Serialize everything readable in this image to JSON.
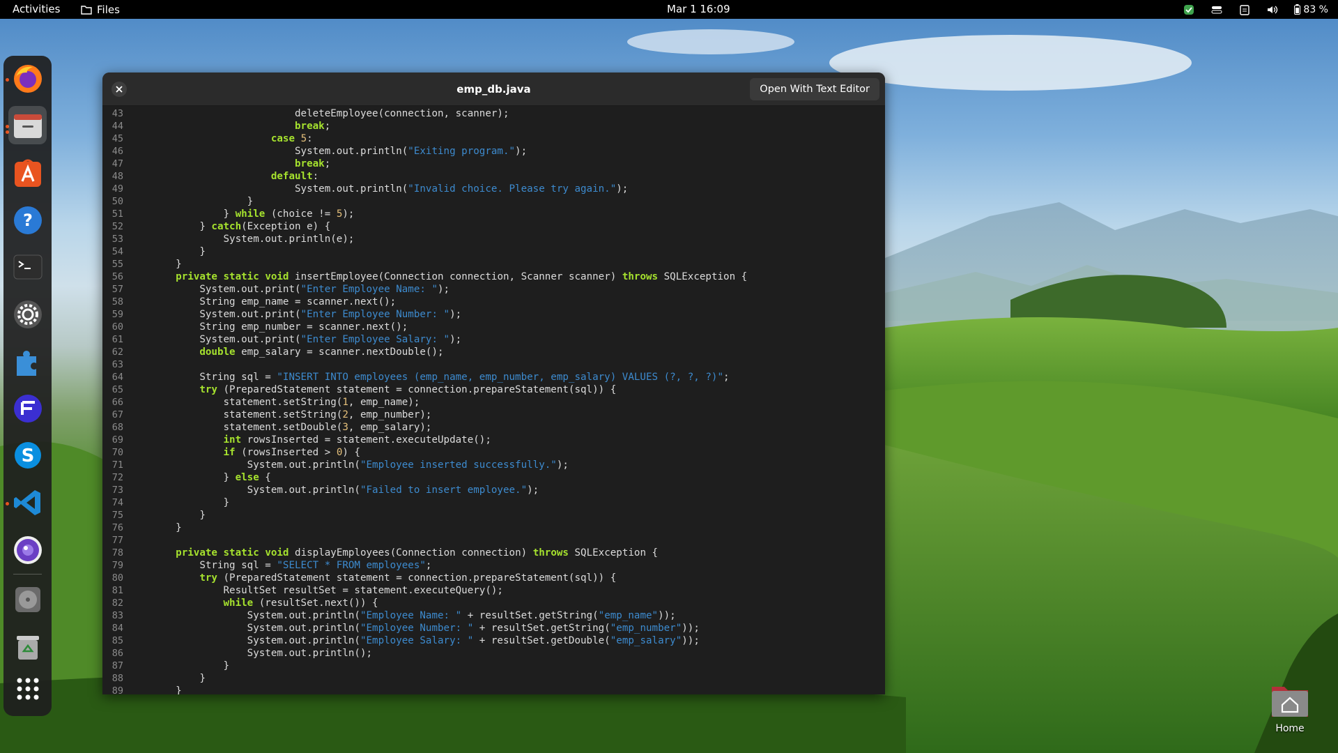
{
  "topbar": {
    "activities": "Activities",
    "app_name": "Files",
    "clock": "Mar 1  16:09",
    "battery": "83 %"
  },
  "dock": {
    "items": [
      {
        "icon": "firefox-icon",
        "running": true
      },
      {
        "icon": "files-icon",
        "running": true,
        "active": true
      },
      {
        "icon": "app-center-icon"
      },
      {
        "icon": "help-icon"
      },
      {
        "icon": "terminal-icon"
      },
      {
        "icon": "settings-icon"
      },
      {
        "icon": "extensions-icon"
      },
      {
        "icon": "app-icon"
      },
      {
        "icon": "skype-icon"
      },
      {
        "icon": "vscode-icon",
        "running": true
      },
      {
        "icon": "webcam-icon"
      },
      {
        "icon": "disc-icon"
      },
      {
        "icon": "trash-icon"
      },
      {
        "icon": "show-apps-icon"
      }
    ]
  },
  "window": {
    "title": "emp_db.java",
    "open_button": "Open With Text Editor"
  },
  "code": {
    "lines": [
      {
        "n": "43",
        "t": "                        deleteEmployee(connection, scanner);"
      },
      {
        "n": "44",
        "t": "                        break;"
      },
      {
        "n": "45",
        "t": "                    case 5:"
      },
      {
        "n": "46",
        "t": "                        System.out.println(\"Exiting program.\");"
      },
      {
        "n": "47",
        "t": "                        break;"
      },
      {
        "n": "48",
        "t": "                    default:"
      },
      {
        "n": "49",
        "t": "                        System.out.println(\"Invalid choice. Please try again.\");"
      },
      {
        "n": "50",
        "t": "                }"
      },
      {
        "n": "51",
        "t": "            } while (choice != 5);"
      },
      {
        "n": "52",
        "t": "        } catch(Exception e) {"
      },
      {
        "n": "53",
        "t": "            System.out.println(e);"
      },
      {
        "n": "54",
        "t": "        }"
      },
      {
        "n": "55",
        "t": "    }"
      },
      {
        "n": "56",
        "t": "    private static void insertEmployee(Connection connection, Scanner scanner) throws SQLException {"
      },
      {
        "n": "57",
        "t": "        System.out.print(\"Enter Employee Name: \");"
      },
      {
        "n": "58",
        "t": "        String emp_name = scanner.next();"
      },
      {
        "n": "59",
        "t": "        System.out.print(\"Enter Employee Number: \");"
      },
      {
        "n": "60",
        "t": "        String emp_number = scanner.next();"
      },
      {
        "n": "61",
        "t": "        System.out.print(\"Enter Employee Salary: \");"
      },
      {
        "n": "62",
        "t": "        double emp_salary = scanner.nextDouble();"
      },
      {
        "n": "63",
        "t": ""
      },
      {
        "n": "64",
        "t": "        String sql = \"INSERT INTO employees (emp_name, emp_number, emp_salary) VALUES (?, ?, ?)\";"
      },
      {
        "n": "65",
        "t": "        try (PreparedStatement statement = connection.prepareStatement(sql)) {"
      },
      {
        "n": "66",
        "t": "            statement.setString(1, emp_name);"
      },
      {
        "n": "67",
        "t": "            statement.setString(2, emp_number);"
      },
      {
        "n": "68",
        "t": "            statement.setDouble(3, emp_salary);"
      },
      {
        "n": "69",
        "t": "            int rowsInserted = statement.executeUpdate();"
      },
      {
        "n": "70",
        "t": "            if (rowsInserted > 0) {"
      },
      {
        "n": "71",
        "t": "                System.out.println(\"Employee inserted successfully.\");"
      },
      {
        "n": "72",
        "t": "            } else {"
      },
      {
        "n": "73",
        "t": "                System.out.println(\"Failed to insert employee.\");"
      },
      {
        "n": "74",
        "t": "            }"
      },
      {
        "n": "75",
        "t": "        }"
      },
      {
        "n": "76",
        "t": "    }"
      },
      {
        "n": "77",
        "t": ""
      },
      {
        "n": "78",
        "t": "    private static void displayEmployees(Connection connection) throws SQLException {"
      },
      {
        "n": "79",
        "t": "        String sql = \"SELECT * FROM employees\";"
      },
      {
        "n": "80",
        "t": "        try (PreparedStatement statement = connection.prepareStatement(sql)) {"
      },
      {
        "n": "81",
        "t": "            ResultSet resultSet = statement.executeQuery();"
      },
      {
        "n": "82",
        "t": "            while (resultSet.next()) {"
      },
      {
        "n": "83",
        "t": "                System.out.println(\"Employee Name: \" + resultSet.getString(\"emp_name\"));"
      },
      {
        "n": "84",
        "t": "                System.out.println(\"Employee Number: \" + resultSet.getString(\"emp_number\"));"
      },
      {
        "n": "85",
        "t": "                System.out.println(\"Employee Salary: \" + resultSet.getDouble(\"emp_salary\"));"
      },
      {
        "n": "86",
        "t": "                System.out.println();"
      },
      {
        "n": "87",
        "t": "            }"
      },
      {
        "n": "88",
        "t": "        }"
      },
      {
        "n": "89",
        "t": "    }"
      }
    ]
  },
  "desktop": {
    "home_label": "Home"
  },
  "colors": {
    "keyword": "#a6e22e",
    "string": "#3d8bcf",
    "number": "#e5c07b",
    "dock_accent": "#e95420"
  }
}
